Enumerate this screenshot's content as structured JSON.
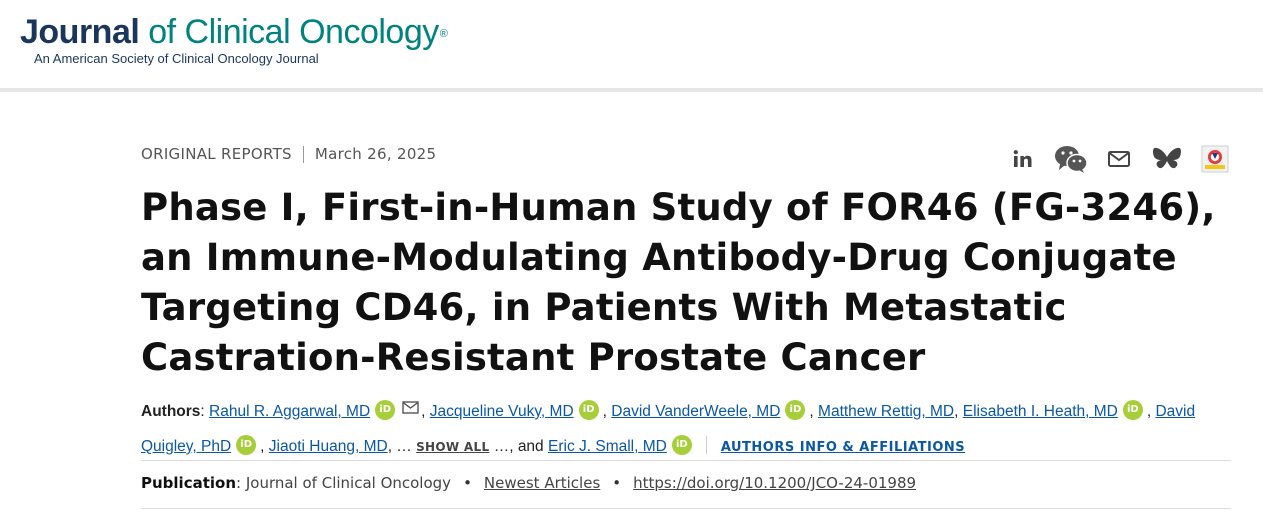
{
  "header": {
    "logo_journal": "Journal",
    "logo_rest": " of Clinical Oncology",
    "logo_reg": "®",
    "logo_sub": "An American Society of Clinical Oncology Journal"
  },
  "article": {
    "type": "ORIGINAL REPORTS",
    "date": "March 26, 2025",
    "title": "Phase I, First-in-Human Study of FOR46 (FG-3246), an Immune-Modulating Antibody-Drug Conjugate Targeting CD46, in Patients With Metastatic Castration-Resistant Prostate Cancer"
  },
  "share": [
    {
      "icon": "linkedin-icon"
    },
    {
      "icon": "wechat-icon"
    },
    {
      "icon": "email-icon"
    },
    {
      "icon": "bluesky-icon"
    },
    {
      "icon": "mendeley-icon"
    }
  ],
  "authors": {
    "label": "Authors",
    "list": [
      "Rahul R. Aggarwal, MD",
      "Jacqueline Vuky, MD",
      "David VanderWeele, MD",
      "Matthew Rettig, MD",
      "Elisabeth I. Heath, MD",
      "David Quigley, PhD",
      "Jiaoti Huang, MD",
      "Eric J. Small, MD"
    ],
    "show_all": "SHOW ALL",
    "and_text": "and",
    "affiliations": "AUTHORS INFO & AFFILIATIONS",
    "orcid_text": "iD"
  },
  "publication": {
    "label": "Publication",
    "journal": "Journal of Clinical Oncology",
    "newest": "Newest Articles",
    "doi": "https://doi.org/10.1200/JCO-24-01989"
  },
  "colors": {
    "brand_navy": "#1b365d",
    "brand_teal": "#00827f",
    "link_blue": "#0a57a4",
    "orcid_green": "#a6ce39"
  }
}
